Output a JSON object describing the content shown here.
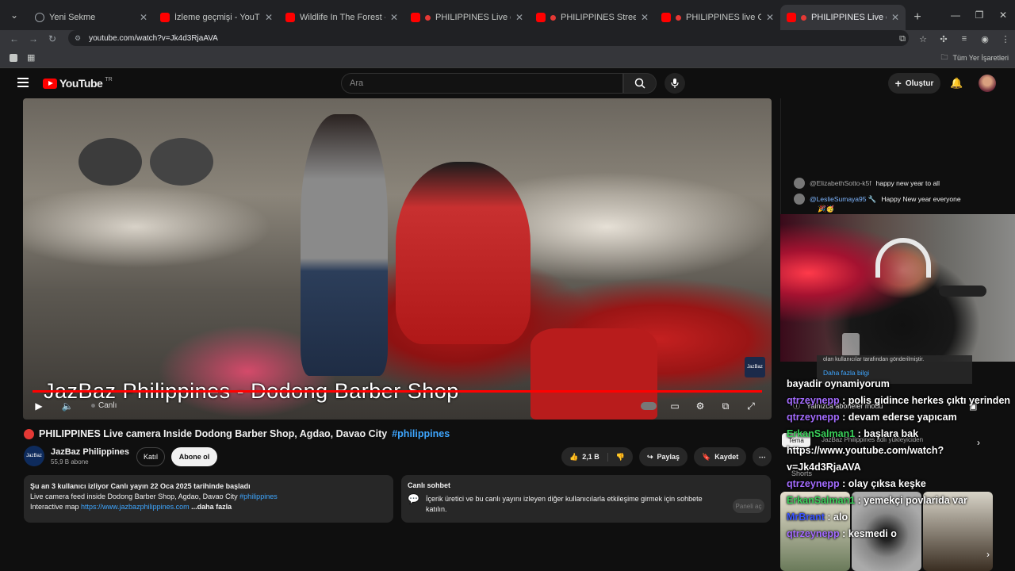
{
  "browser": {
    "tabs": [
      {
        "title": "Yeni Sekme",
        "icon": "globe-icon",
        "live": false,
        "active": false
      },
      {
        "title": "İzleme geçmişi - YouTube",
        "icon": "youtube-icon",
        "live": false,
        "active": false
      },
      {
        "title": "Wildlife In The Forest - 24/7 LIV",
        "icon": "youtube-icon",
        "live": false,
        "active": false
      },
      {
        "title": "PHILIPPINES Live camera Va",
        "icon": "youtube-icon",
        "live": true,
        "active": false
      },
      {
        "title": "PHILIPPINES Street View Liv",
        "icon": "youtube-icon",
        "live": true,
        "active": false
      },
      {
        "title": "PHILIPPINES live Cam Strea",
        "icon": "youtube-icon",
        "live": true,
        "active": false
      },
      {
        "title": "PHILIPPINES Live camera In",
        "icon": "youtube-icon",
        "live": true,
        "active": true
      }
    ],
    "url": "youtube.com/watch?v=Jk4d3RjaAVA",
    "bookmarks_all": "Tüm Yer İşaretleri"
  },
  "youtube": {
    "logo_text": "YouTube",
    "country": "TR",
    "search_placeholder": "Ara",
    "create_label": "Oluştur"
  },
  "player": {
    "overlay_title": "JazBaz Philippines - Dodong Barber Shop",
    "live_label": "Canlı",
    "watermark": "JazBaz",
    "progress_fraction": 1.0
  },
  "video": {
    "title": "PHILIPPINES Live camera Inside Dodong Barber Shop, Agdao, Davao City",
    "hashtag": "#philippines",
    "channel": "JazBaz Philippines",
    "subscribers": "55,9 B abone",
    "join_label": "Katıl",
    "subscribe_label": "Abone ol",
    "likes": "2,1 B",
    "share_label": "Paylaş",
    "save_label": "Kaydet",
    "description": {
      "stats": "Şu an 3 kullanıcı izliyor  Canlı yayın 22 Oca 2025 tarihinde başladı",
      "line1": "Live camera feed inside Dodong Barber Shop, Agdao, Davao City ",
      "line1_tag": "#philippines",
      "line2_prefix": "Interactive map ",
      "line2_link": "https://www.jazbazphilippines.com",
      "more": " ...daha fazla"
    },
    "live_chat": {
      "heading": "Canlı sohbet",
      "text": "İçerik üretici ve bu canlı yayını izleyen diğer kullanıcılarla etkileşime girmek için sohbete katılın.",
      "button": "Paneli aç"
    }
  },
  "chat": {
    "messages": [
      {
        "user": "@ElizabethSotto-k5f",
        "text": "happy new year to all",
        "mod": false
      },
      {
        "user": "@LeslieSumaya95 🔧",
        "text": "Happy New year everyone",
        "mod": true
      }
    ],
    "emoji_line": "🎉🥳"
  },
  "overlay": {
    "info_text": "olan kullanıcılar tarafından gönderilmiştir.",
    "more_info": "Daha fazla bilgi",
    "subs_only": "Yalnızca aboneler modu",
    "theme_chip": "Tema",
    "uploaded_by": "JazBaz Philippines adlı yükleyiciden",
    "shorts": "Shorts",
    "stream_chat": [
      {
        "user": "",
        "text": "bayadir oynamiyorum",
        "color": "u0"
      },
      {
        "user": "qtrzeynepp",
        "text": " : polis gidince herkes çıktı yerinden",
        "color": "u1"
      },
      {
        "user": "qtrzeynepp",
        "text": " : devam ederse yapıcam",
        "color": "u1"
      },
      {
        "user": "ErkanSalman1",
        "text": " : başlara bak",
        "color": "u2"
      },
      {
        "user": "",
        "text": "https://www.youtube.com/watch?",
        "color": "u0"
      },
      {
        "user": "",
        "text": "v=Jk4d3RjaAVA",
        "color": "u0"
      },
      {
        "user": "qtrzeynepp",
        "text": " : olay çıksa keşke",
        "color": "u1"
      },
      {
        "user": "ErkanSalman1",
        "text": " : yemekçi povlarida var",
        "color": "u2"
      },
      {
        "user": "MrBrant",
        "text": " : alo",
        "color": "u3"
      },
      {
        "user": "qtrzeynepp",
        "text": " : kesmedi o",
        "color": "u1"
      }
    ]
  }
}
